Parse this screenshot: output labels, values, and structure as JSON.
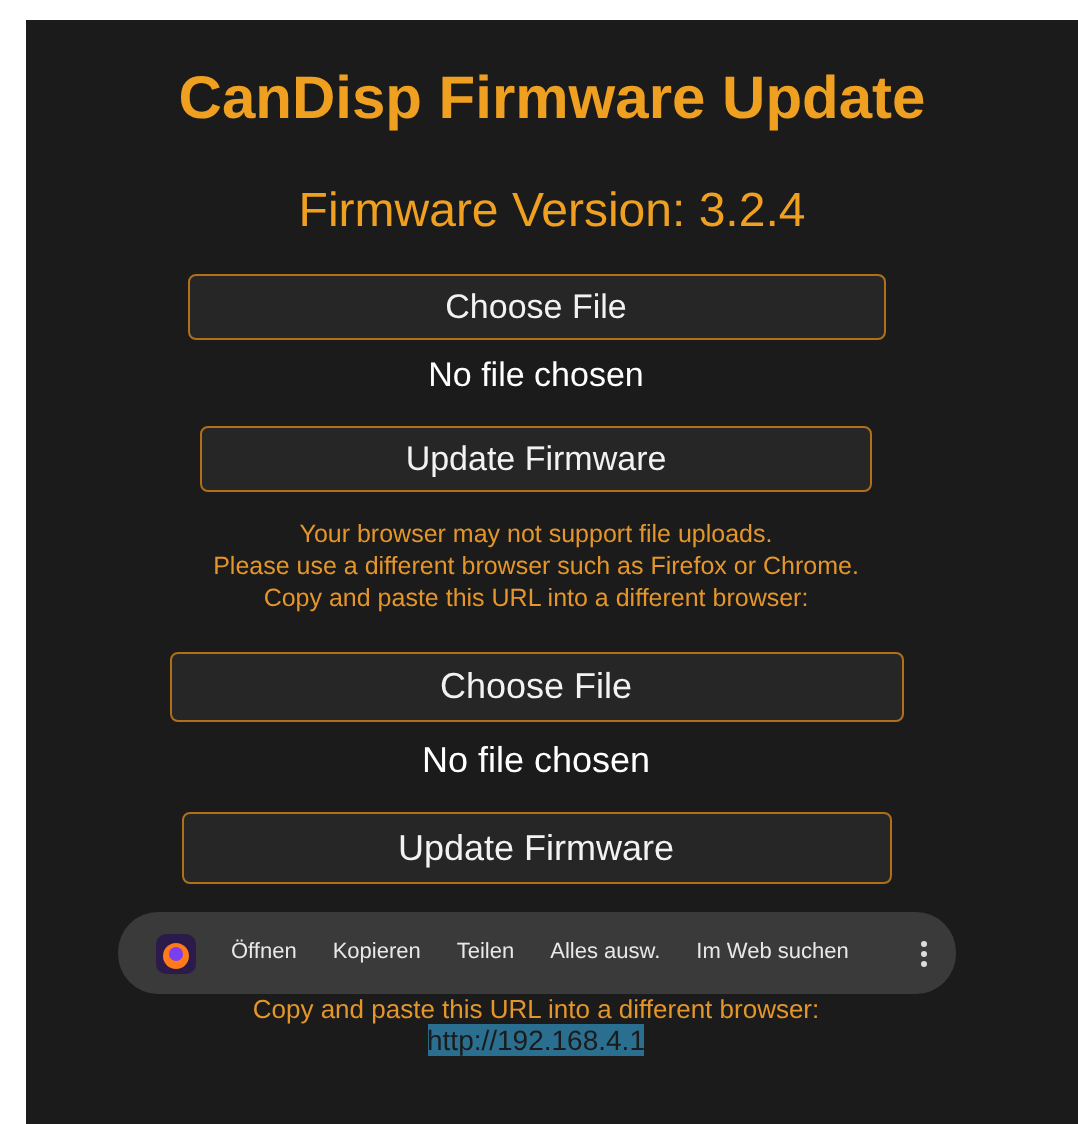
{
  "title": "CanDisp Firmware Update",
  "version": "Firmware Version: 3.2.4",
  "first_form": {
    "choose_button": "Choose File",
    "file_status": "No file chosen",
    "update_button": "Update Firmware"
  },
  "warning_lines": [
    "Your browser may not support file uploads.",
    "Please use a different browser such as Firefox or Chrome.",
    "Copy and paste this URL into a different browser:"
  ],
  "second_form": {
    "choose_button": "Choose File",
    "file_status": "No file chosen",
    "update_button": "Update Firmware"
  },
  "context_menu": {
    "items": [
      "Öffnen",
      "Kopieren",
      "Teilen",
      "Alles ausw.",
      "Im Web suchen"
    ]
  },
  "copy_hint": "Copy and paste this URL into a different browser:",
  "url": {
    "text": "http://192.168.4.1",
    "selected": true
  }
}
